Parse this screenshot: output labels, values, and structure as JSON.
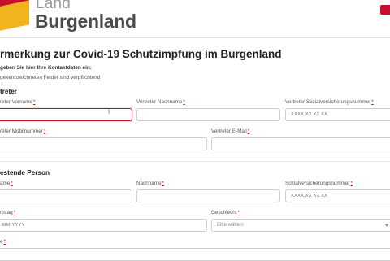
{
  "header": {
    "brand_top": "Land",
    "brand_main": "Burgenland"
  },
  "form": {
    "title": "rmerkung zur Covid-19 Schutzimpfung im Burgenland",
    "intro_line1": "geben Sie hier Ihre Kontaktdaten ein:",
    "intro_line2": "gekennzeichneten Felder sind verpflichtend"
  },
  "representative": {
    "section_title": "treter",
    "first_name_label": "reter Vorname",
    "last_name_label": "Vertreter Nachname",
    "ssn_label": "Vertreter Sozialversicherungsnummer",
    "ssn_placeholder": "XXXX XX XX XX",
    "mobile_label": "reter Mobilnummer",
    "email_label": "Vertreter E-Mail"
  },
  "person": {
    "section_title": "estende Person",
    "first_name_label": "ame",
    "last_name_label": "Nachname",
    "ssn_label": "Sozialversicherungsnummer",
    "ssn_placeholder": "XXXX XX XX XX",
    "birthdate_label": "rtstag",
    "birthdate_placeholder": ".MM.YYYY",
    "gender_label": "Geschlecht",
    "gender_placeholder": "Bitte wählen",
    "next_label": "e"
  },
  "required_marker": "*",
  "colors": {
    "accent": "#c8102e",
    "gold": "#f0b41e"
  }
}
